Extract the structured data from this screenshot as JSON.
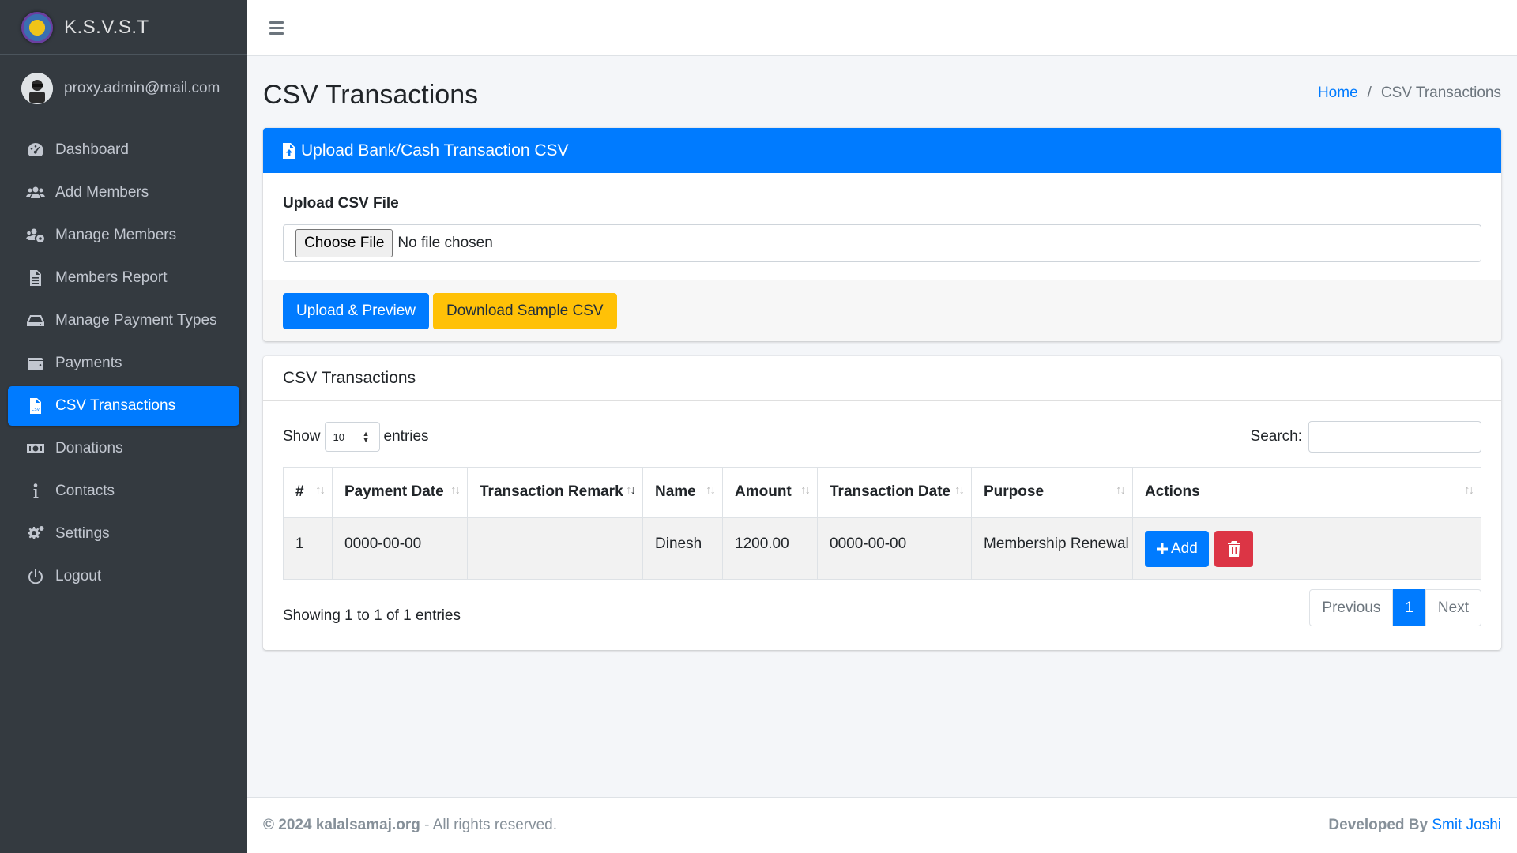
{
  "brand": {
    "name": "K.S.V.S.T"
  },
  "user": {
    "email": "proxy.admin@mail.com"
  },
  "sidebar": {
    "items": [
      {
        "label": "Dashboard",
        "icon": "dashboard-icon"
      },
      {
        "label": "Add Members",
        "icon": "users-icon"
      },
      {
        "label": "Manage Members",
        "icon": "users-cog-icon"
      },
      {
        "label": "Members Report",
        "icon": "file-alt-icon"
      },
      {
        "label": "Manage Payment Types",
        "icon": "hdd-icon"
      },
      {
        "label": "Payments",
        "icon": "wallet-icon"
      },
      {
        "label": "CSV Transactions",
        "icon": "file-csv-icon",
        "active": true
      },
      {
        "label": "Donations",
        "icon": "money-bill-icon"
      },
      {
        "label": "Contacts",
        "icon": "info-icon"
      },
      {
        "label": "Settings",
        "icon": "cogs-icon"
      },
      {
        "label": "Logout",
        "icon": "power-icon"
      }
    ]
  },
  "header": {
    "title": "CSV Transactions",
    "breadcrumb": {
      "home": "Home",
      "separator": "/",
      "current": "CSV Transactions"
    }
  },
  "upload": {
    "card_title": "Upload Bank/Cash Transaction CSV",
    "label": "Upload CSV File",
    "choose_button": "Choose File",
    "file_status": "No file chosen",
    "upload_button": "Upload & Preview",
    "sample_button": "Download Sample CSV"
  },
  "table_card": {
    "title": "CSV Transactions",
    "show_label": "Show",
    "entries_value": "10",
    "entries_label": "entries",
    "search_label": "Search:",
    "columns": [
      "#",
      "Payment Date",
      "Transaction Remark",
      "Name",
      "Amount",
      "Transaction Date",
      "Purpose",
      "Actions"
    ],
    "rows": [
      {
        "num": "1",
        "payment_date": "0000-00-00",
        "remark": "",
        "name": "Dinesh",
        "amount": "1200.00",
        "transaction_date": "0000-00-00",
        "purpose": "Membership Renewal",
        "add_label": "Add"
      }
    ],
    "info": "Showing 1 to 1 of 1 entries",
    "pagination": {
      "previous": "Previous",
      "current": "1",
      "next": "Next"
    }
  },
  "footer": {
    "copyright": "© 2024 kalalsamaj.org",
    "rights": " - All rights reserved.",
    "developed_by": "Developed By",
    "developer": "Smit Joshi"
  },
  "colors": {
    "sidebar_bg": "#343a40",
    "primary": "#007bff",
    "warning": "#ffc107",
    "danger": "#dc3545",
    "content_bg": "#f4f6f9"
  }
}
